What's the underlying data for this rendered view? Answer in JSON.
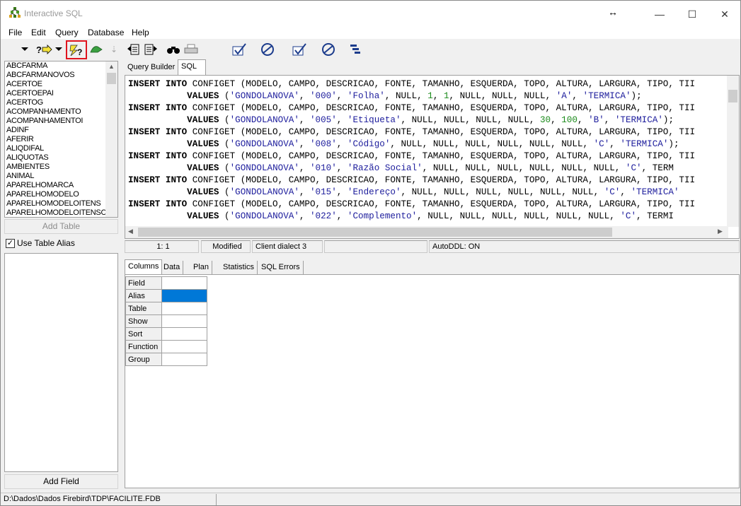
{
  "window": {
    "title": "Interactive SQL",
    "resize_glyph": "↔",
    "minimize": "—",
    "maximize": "☐",
    "close": "✕"
  },
  "menu": [
    "File",
    "Edit",
    "Query",
    "Database",
    "Help"
  ],
  "toolbar": {
    "icons": [
      "dropdown-arrow-icon",
      "help-arrow-icon",
      "execute-query-icon",
      "prepare-icon",
      "step-icon",
      "previous-query-icon",
      "next-query-icon",
      "find-icon",
      "print-icon",
      "commit-icon",
      "rollback-icon",
      "commit-all-icon",
      "rollback-all-icon",
      "plan-icon"
    ]
  },
  "tables": [
    "ABCFARMA",
    "ABCFARMANOVOS",
    "ACERTOE",
    "ACERTOEPAI",
    "ACERTOG",
    "ACOMPANHAMENTO",
    "ACOMPANHAMENTOI",
    "ADINF",
    "AFERIR",
    "ALIQDIFAL",
    "ALIQUOTAS",
    "AMBIENTES",
    "ANIMAL",
    "APARELHOMARCA",
    "APARELHOMODELO",
    "APARELHOMODELOITENS",
    "APARELHOMODELOITENSC"
  ],
  "left_panel": {
    "add_table": "Add Table",
    "use_alias": "Use Table Alias",
    "use_alias_checked": "✓",
    "add_field": "Add Field"
  },
  "editor_tabs": [
    "Query Builder",
    "SQL"
  ],
  "sql_lines": [
    {
      "insert": "INSERT INTO",
      "rest": " CONFIGET (MODELO, CAMPO, DESCRICAO, FONTE, TAMANHO, ESQUERDA, TOPO, ALTURA, LARGURA, TIPO, TII"
    },
    {
      "indent": "           ",
      "values": "VALUES",
      "rest": " ('GONDOLANOVA', '000', 'Folha', NULL, 1, 1, NULL, NULL, NULL, 'A', 'TERMICA');"
    },
    {
      "insert": "INSERT INTO",
      "rest": " CONFIGET (MODELO, CAMPO, DESCRICAO, FONTE, TAMANHO, ESQUERDA, TOPO, ALTURA, LARGURA, TIPO, TII"
    },
    {
      "indent": "           ",
      "values": "VALUES",
      "rest": " ('GONDOLANOVA', '005', 'Etiqueta', NULL, NULL, NULL, NULL, 30, 100, 'B', 'TERMICA');"
    },
    {
      "insert": "INSERT INTO",
      "rest": " CONFIGET (MODELO, CAMPO, DESCRICAO, FONTE, TAMANHO, ESQUERDA, TOPO, ALTURA, LARGURA, TIPO, TII"
    },
    {
      "indent": "           ",
      "values": "VALUES",
      "rest": " ('GONDOLANOVA', '008', 'Código', NULL, NULL, NULL, NULL, NULL, NULL, 'C', 'TERMICA');"
    },
    {
      "insert": "INSERT INTO",
      "rest": " CONFIGET (MODELO, CAMPO, DESCRICAO, FONTE, TAMANHO, ESQUERDA, TOPO, ALTURA, LARGURA, TIPO, TII"
    },
    {
      "indent": "           ",
      "values": "VALUES",
      "rest": " ('GONDOLANOVA', '010', 'Razão Social', NULL, NULL, NULL, NULL, NULL, NULL, 'C', 'TERM"
    },
    {
      "insert": "INSERT INTO",
      "rest": " CONFIGET (MODELO, CAMPO, DESCRICAO, FONTE, TAMANHO, ESQUERDA, TOPO, ALTURA, LARGURA, TIPO, TII"
    },
    {
      "indent": "           ",
      "values": "VALUES",
      "rest": " ('GONDOLANOVA', '015', 'Endereço', NULL, NULL, NULL, NULL, NULL, NULL, 'C', 'TERMICA'"
    },
    {
      "insert": "INSERT INTO",
      "rest": " CONFIGET (MODELO, CAMPO, DESCRICAO, FONTE, TAMANHO, ESQUERDA, TOPO, ALTURA, LARGURA, TIPO, TII"
    },
    {
      "indent": "           ",
      "values": "VALUES",
      "rest": " ('GONDOLANOVA', '022', 'Complemento', NULL, NULL, NULL, NULL, NULL, NULL, 'C', 'TERMI"
    }
  ],
  "status": {
    "position": "1:  1",
    "modified": "Modified",
    "dialect": "Client dialect 3",
    "autoddl": "AutoDDL: ON"
  },
  "result_tabs": [
    "Columns",
    "Data",
    "Plan",
    "Statistics",
    "SQL Errors"
  ],
  "grid_rows": [
    "Field",
    "Alias",
    "Table",
    "Show",
    "Sort",
    "Function",
    "Group"
  ],
  "statusbar": {
    "path": "D:\\Dados\\Dados Firebird\\TDP\\FACILITE.FDB"
  },
  "colors": {
    "highlight": "#e0141e",
    "selection": "#0078d7",
    "string": "#1c1c9c",
    "number": "#1a8a1a"
  }
}
